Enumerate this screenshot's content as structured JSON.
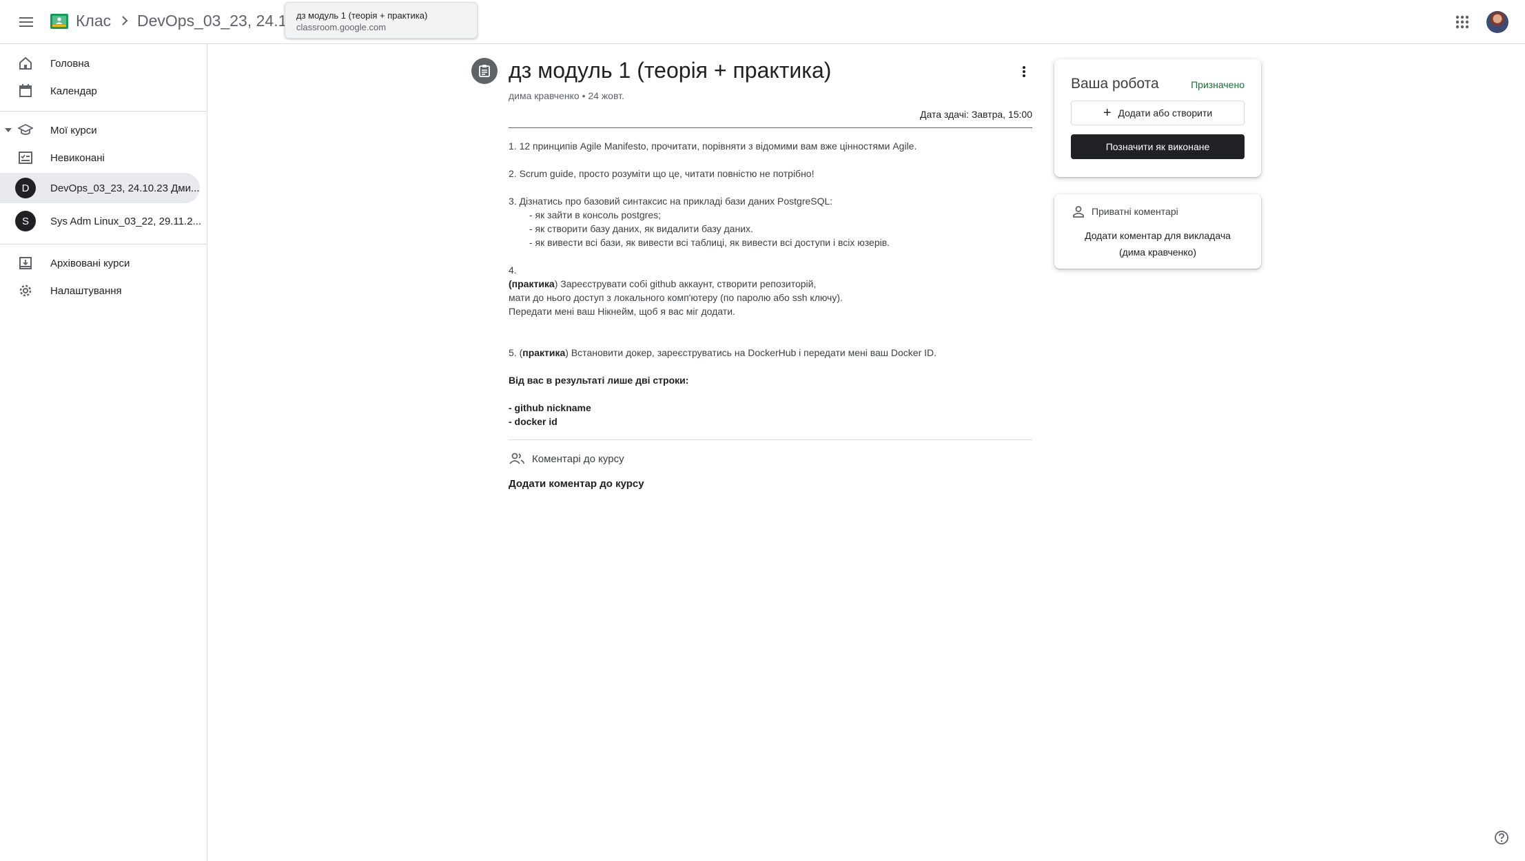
{
  "topbar": {
    "app_name": "Клас",
    "course_crumb": "DevOps_03_23, 24.10.",
    "tooltip_title": "дз модуль 1 (теорія + практика)",
    "tooltip_url": "classroom.google.com"
  },
  "sidebar": {
    "home": "Головна",
    "calendar": "Календар",
    "my_courses": "Мої курси",
    "todo": "Невиконані",
    "courses": [
      {
        "letter": "D",
        "label": "DevOps_03_23, 24.10.23 Дми..."
      },
      {
        "letter": "S",
        "label": "Sys Adm Linux_03_22, 29.11.2..."
      }
    ],
    "archived": "Архівовані курси",
    "settings": "Налаштування"
  },
  "assignment": {
    "title": "дз модуль 1 (теорія + практика)",
    "meta": "дима кравченко • 24 жовт.",
    "due": "Дата здачі: Завтра, 15:00",
    "lines": {
      "l1": "1. 12 принципів Agile Manifesto, прочитати, порівняти з відомими вам вже цінностями Agile.",
      "l2": "2. Scrum guide, просто розуміти що це, читати повністю не потрібно!",
      "l3": "3. Дізнатись про базовий синтаксис на прикладі бази даних PostgreSQL:",
      "l3a": "- як зайти в консоль postgres;",
      "l3b": "- як створити базу даних, як видалити базу даних.",
      "l3c": "- як вивести всі бази, як вивести всі таблиці, як вивести всі доступи і всіх юзерів.",
      "l4": "4.",
      "l4_bold": "(практика",
      "l4_rest": ") Зареєструвати собі github аккаунт, створити репозиторій,",
      "l4b": "мати до нього доступ з локального комп'ютеру (по паролю або ssh ключу).",
      "l4c": "Передати мені ваш Нікнейм, щоб я вас міг додати.",
      "l5_pre": "5. (",
      "l5_bold": "практика",
      "l5_rest": ") Встановити докер, зареєструватись на DockerHub і передати мені ваш Docker ID.",
      "result": "Від вас в результаті лише дві строки:",
      "r1": "- github nickname",
      "r2": "- docker id"
    },
    "class_comments_label": "Коментарі до курсу",
    "add_class_comment": "Додати коментар до курсу"
  },
  "work_card": {
    "title": "Ваша робота",
    "status": "Призначено",
    "add_button": "Додати або створити",
    "done_button": "Позначити як виконане"
  },
  "private_card": {
    "label": "Приватні коментарі",
    "add_line1": "Додати коментар для викладача",
    "add_line2": "(дима кравченко)"
  },
  "colors": {
    "status_green": "#137333",
    "dark_button": "#202124",
    "active_nav": "#e8eaed"
  },
  "icons": [
    "menu-icon",
    "classroom-logo-icon",
    "chevron-right-icon",
    "apps-grid-icon",
    "home-icon",
    "calendar-icon",
    "school-icon",
    "todo-icon",
    "archive-icon",
    "settings-icon",
    "assignment-icon",
    "more-vert-icon",
    "people-icon",
    "person-icon",
    "plus-icon",
    "help-icon"
  ]
}
